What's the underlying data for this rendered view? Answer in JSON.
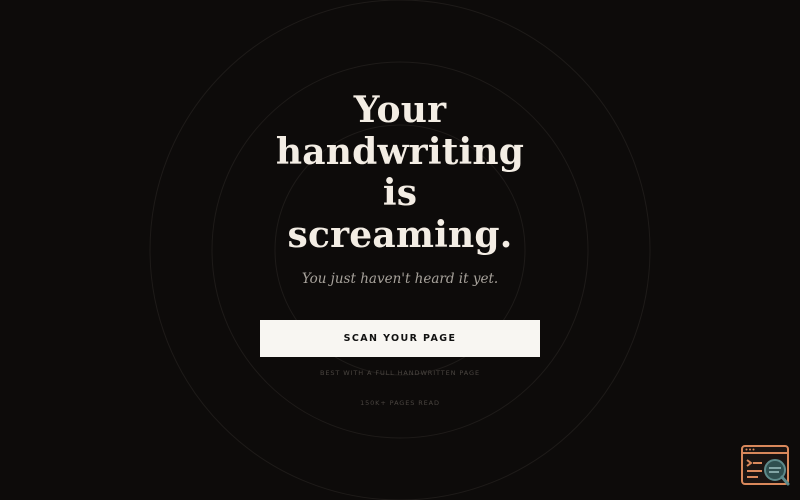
{
  "hero": {
    "headline_lines": [
      "Your",
      "handwriting",
      "is",
      "screaming."
    ],
    "subtitle": "You just haven't heard it yet.",
    "cta_label": "SCAN YOUR PAGE",
    "hint": "BEST WITH A FULL HANDWRITTEN PAGE",
    "stat": "150K+ PAGES READ"
  },
  "widget": {
    "icon": "browser-search-icon"
  },
  "colors": {
    "background": "#0d0b0a",
    "headline": "#f3ede4",
    "subtitle": "#a7a29b",
    "cta_background": "#f8f6f2",
    "cta_text": "#111111",
    "muted_text": "#4a4540",
    "ring": "#1e1b19",
    "widget_accent": "#d9885b",
    "widget_lens": "#2f4f4f"
  }
}
